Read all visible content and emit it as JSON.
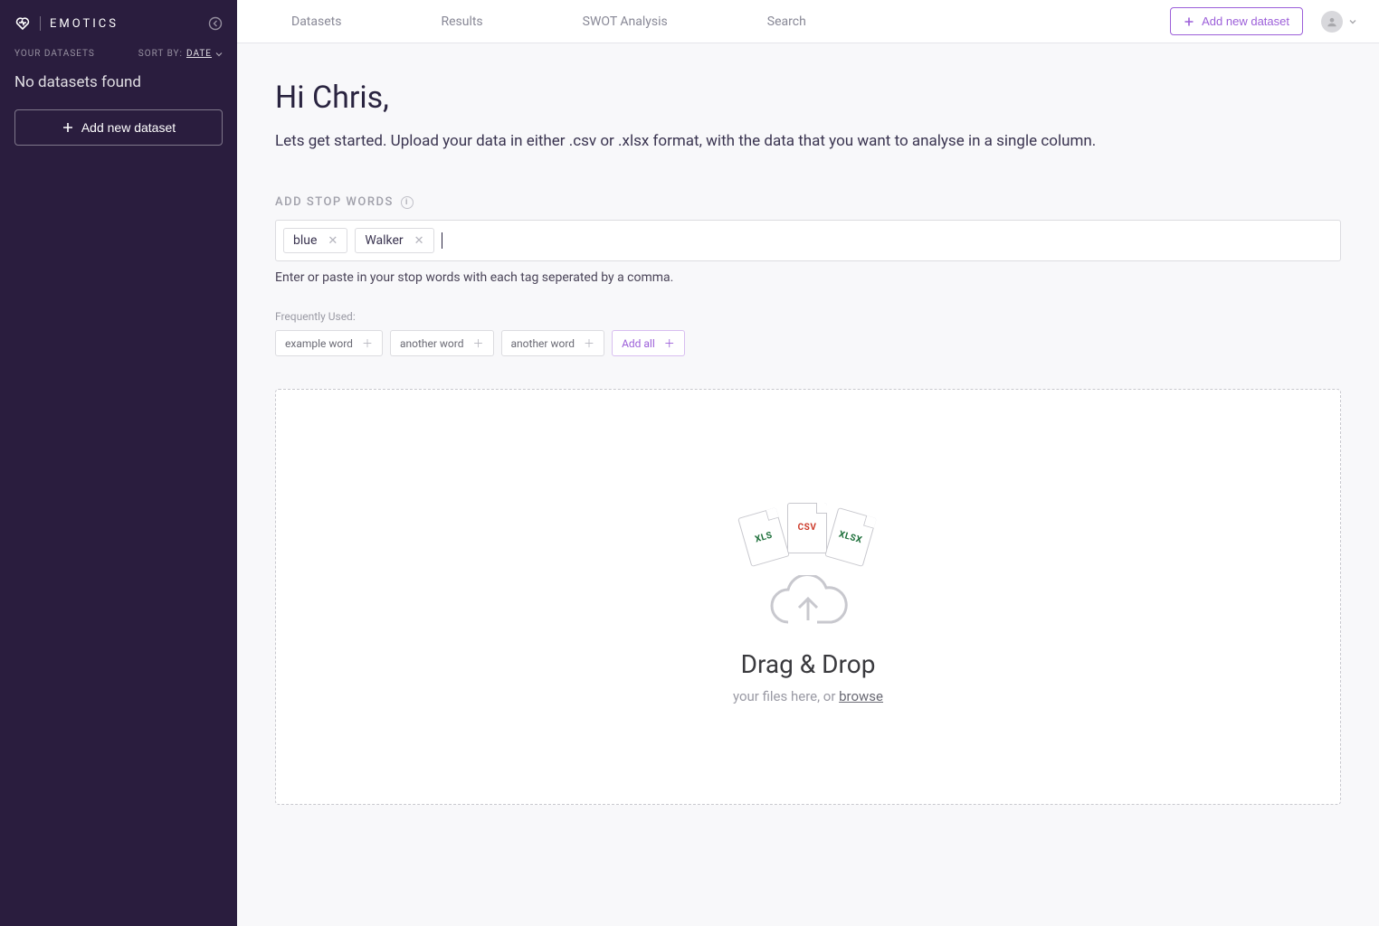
{
  "brand": {
    "name": "EMOTICS"
  },
  "sidebar": {
    "your_datasets_label": "YOUR DATASETS",
    "sort_by_label": "SORT BY:",
    "sort_by_value": "DATE",
    "empty_text": "No datasets found",
    "add_button": "Add new dataset"
  },
  "topbar": {
    "tabs": [
      {
        "label": "Datasets"
      },
      {
        "label": "Results"
      },
      {
        "label": "SWOT Analysis"
      },
      {
        "label": "Search"
      }
    ],
    "add_button": "Add new dataset"
  },
  "main": {
    "greeting": "Hi Chris,",
    "subtitle": "Lets get started. Upload your data in either .csv or .xlsx format, with the data that you want to analyse in a single column.",
    "stopwords": {
      "label": "ADD STOP WORDS",
      "chips": [
        "blue",
        "Walker"
      ],
      "hint": "Enter or paste in your stop words with each tag seperated by a comma."
    },
    "frequent": {
      "label": "Frequently Used:",
      "items": [
        "example word",
        "another word",
        "another word"
      ],
      "add_all": "Add all"
    },
    "dropzone": {
      "files": {
        "xls": "XLS",
        "csv": "CSV",
        "xlsx": "XLSX"
      },
      "title": "Drag & Drop",
      "subtitle_prefix": "your files here, or ",
      "browse": "browse"
    }
  }
}
